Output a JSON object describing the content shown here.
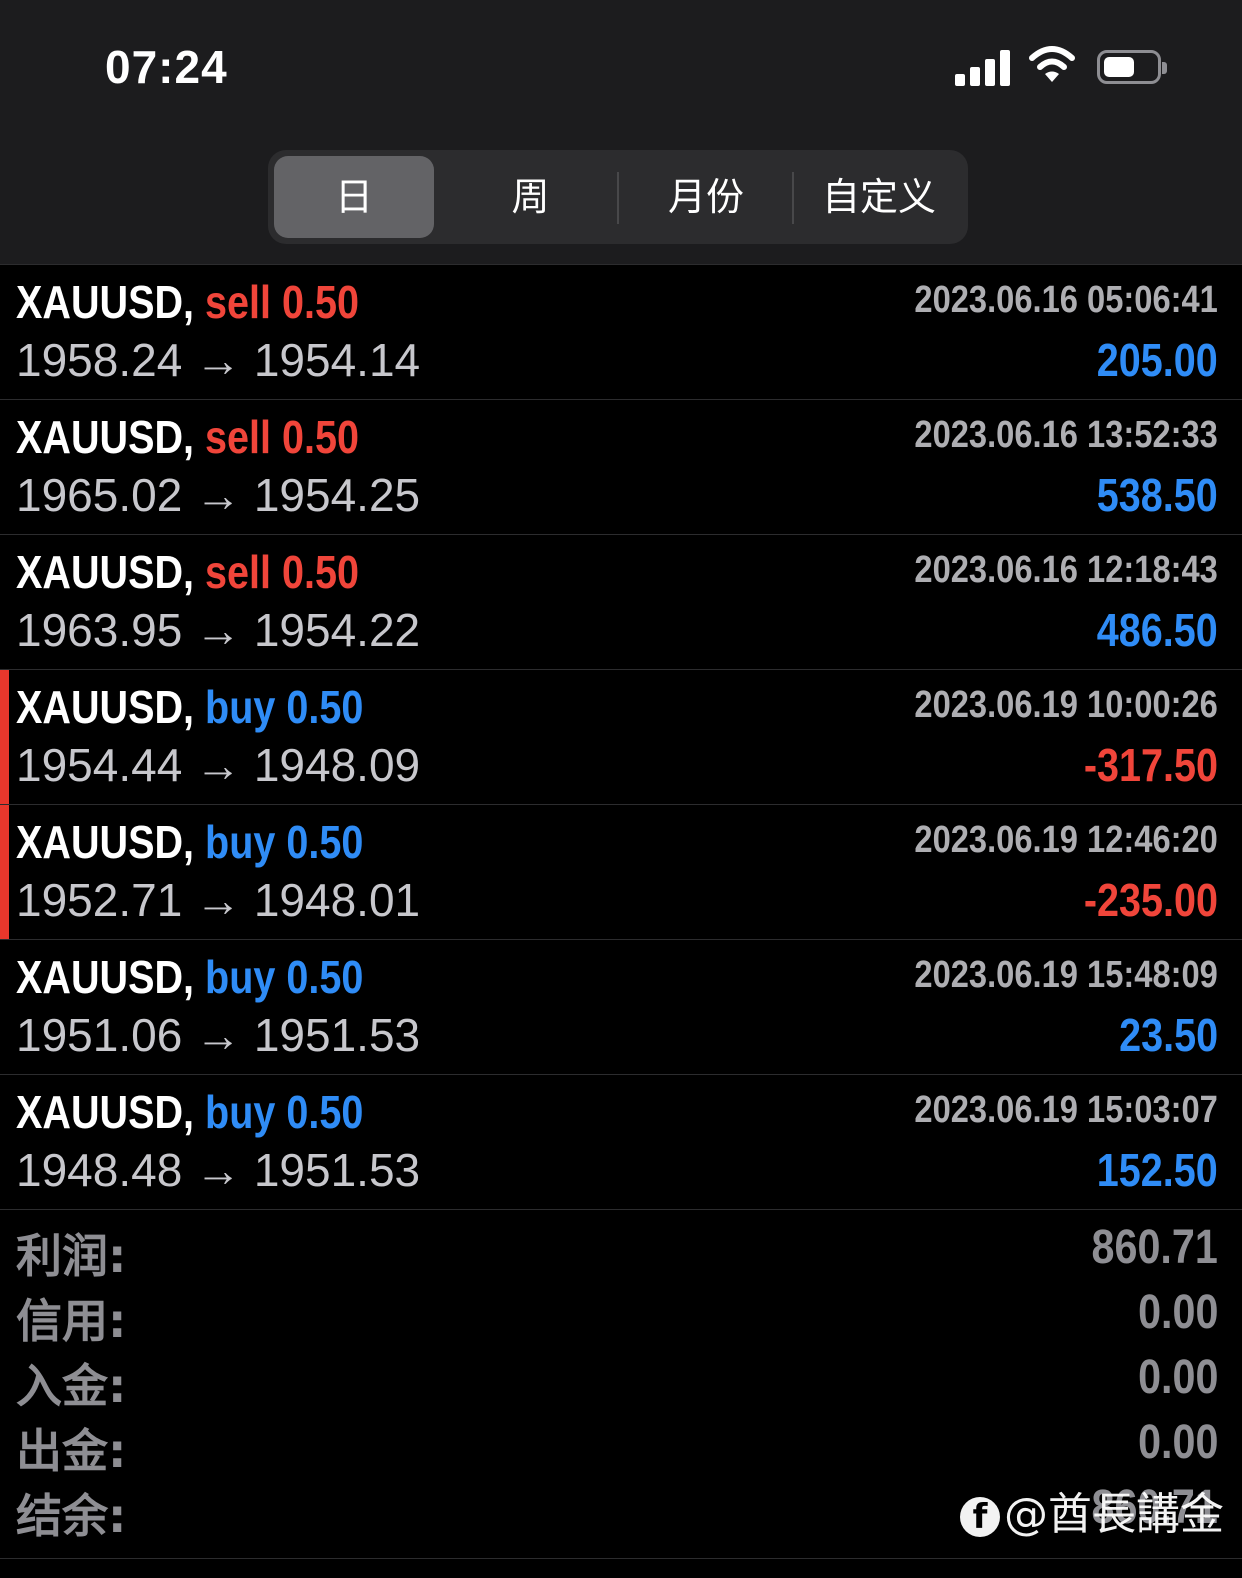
{
  "status_bar": {
    "time": "07:24",
    "icons": [
      "signal-icon",
      "wifi-icon",
      "battery-icon"
    ]
  },
  "segments": [
    {
      "label": "日",
      "active": true
    },
    {
      "label": "周",
      "active": false
    },
    {
      "label": "月份",
      "active": false
    },
    {
      "label": "自定义",
      "active": false
    }
  ],
  "trades": [
    {
      "symbol": "XAUUSD,",
      "direction": "sell",
      "volume": "0.50",
      "open": "1958.24",
      "close": "1954.14",
      "arrow": "→",
      "time": "2023.06.16 05:06:41",
      "profit": "205.00",
      "highlight": false
    },
    {
      "symbol": "XAUUSD,",
      "direction": "sell",
      "volume": "0.50",
      "open": "1965.02",
      "close": "1954.25",
      "arrow": "→",
      "time": "2023.06.16 13:52:33",
      "profit": "538.50",
      "highlight": false
    },
    {
      "symbol": "XAUUSD,",
      "direction": "sell",
      "volume": "0.50",
      "open": "1963.95",
      "close": "1954.22",
      "arrow": "→",
      "time": "2023.06.16 12:18:43",
      "profit": "486.50",
      "highlight": false
    },
    {
      "symbol": "XAUUSD,",
      "direction": "buy",
      "volume": "0.50",
      "open": "1954.44",
      "close": "1948.09",
      "arrow": "→",
      "time": "2023.06.19 10:00:26",
      "profit": "-317.50",
      "highlight": true
    },
    {
      "symbol": "XAUUSD,",
      "direction": "buy",
      "volume": "0.50",
      "open": "1952.71",
      "close": "1948.01",
      "arrow": "→",
      "time": "2023.06.19 12:46:20",
      "profit": "-235.00",
      "highlight": true
    },
    {
      "symbol": "XAUUSD,",
      "direction": "buy",
      "volume": "0.50",
      "open": "1951.06",
      "close": "1951.53",
      "arrow": "→",
      "time": "2023.06.19 15:48:09",
      "profit": "23.50",
      "highlight": false
    },
    {
      "symbol": "XAUUSD,",
      "direction": "buy",
      "volume": "0.50",
      "open": "1948.48",
      "close": "1951.53",
      "arrow": "→",
      "time": "2023.06.19 15:03:07",
      "profit": "152.50",
      "highlight": false
    }
  ],
  "summary": [
    {
      "label": "利润:",
      "value": "860.71"
    },
    {
      "label": "信用:",
      "value": "0.00"
    },
    {
      "label": "入金:",
      "value": "0.00"
    },
    {
      "label": "出金:",
      "value": "0.00"
    },
    {
      "label": "结余:",
      "value": "860.71"
    }
  ],
  "watermark": {
    "icon": "f",
    "text": "@酋長講金"
  },
  "colors": {
    "sell": "#f0453a",
    "buy": "#2f8cf6",
    "loss": "#f0453a",
    "gain": "#2f8cf6"
  }
}
